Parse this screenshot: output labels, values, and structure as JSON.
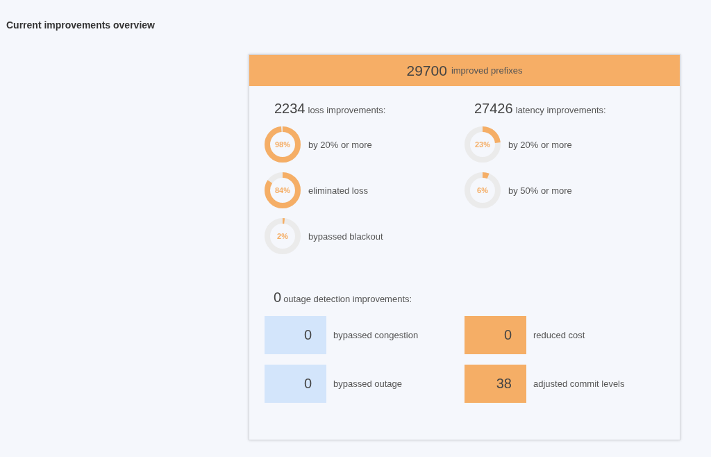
{
  "page_title": "Current improvements overview",
  "summary": {
    "count": "29700",
    "label": "improved prefixes"
  },
  "groups": [
    {
      "count": "2234",
      "label": "loss improvements:",
      "items": [
        {
          "percent": "98%",
          "level": 0.98,
          "label": "by 20% or more"
        },
        {
          "percent": "84%",
          "level": 0.84,
          "label": "eliminated loss"
        },
        {
          "percent": "2%",
          "level": 0.02,
          "label": "bypassed blackout"
        }
      ]
    },
    {
      "count": "27426",
      "label": "latency improvements:",
      "items": [
        {
          "percent": "23%",
          "level": 0.23,
          "label": "by 20% or more"
        },
        {
          "percent": "6%",
          "level": 0.06,
          "label": "by 50% or more"
        }
      ]
    }
  ],
  "outage": {
    "count": "0",
    "label": "outage detection improvements:"
  },
  "tiles": [
    [
      {
        "value": "0",
        "label": "bypassed congestion",
        "color": "#d3e5fb"
      },
      {
        "value": "0",
        "label": "bypassed outage",
        "color": "#d3e5fb"
      }
    ],
    [
      {
        "value": "0",
        "label": "reduced cost",
        "color": "#f5ae66"
      },
      {
        "value": "38",
        "label": "adjusted commit levels",
        "color": "#f5ae66"
      }
    ]
  ]
}
